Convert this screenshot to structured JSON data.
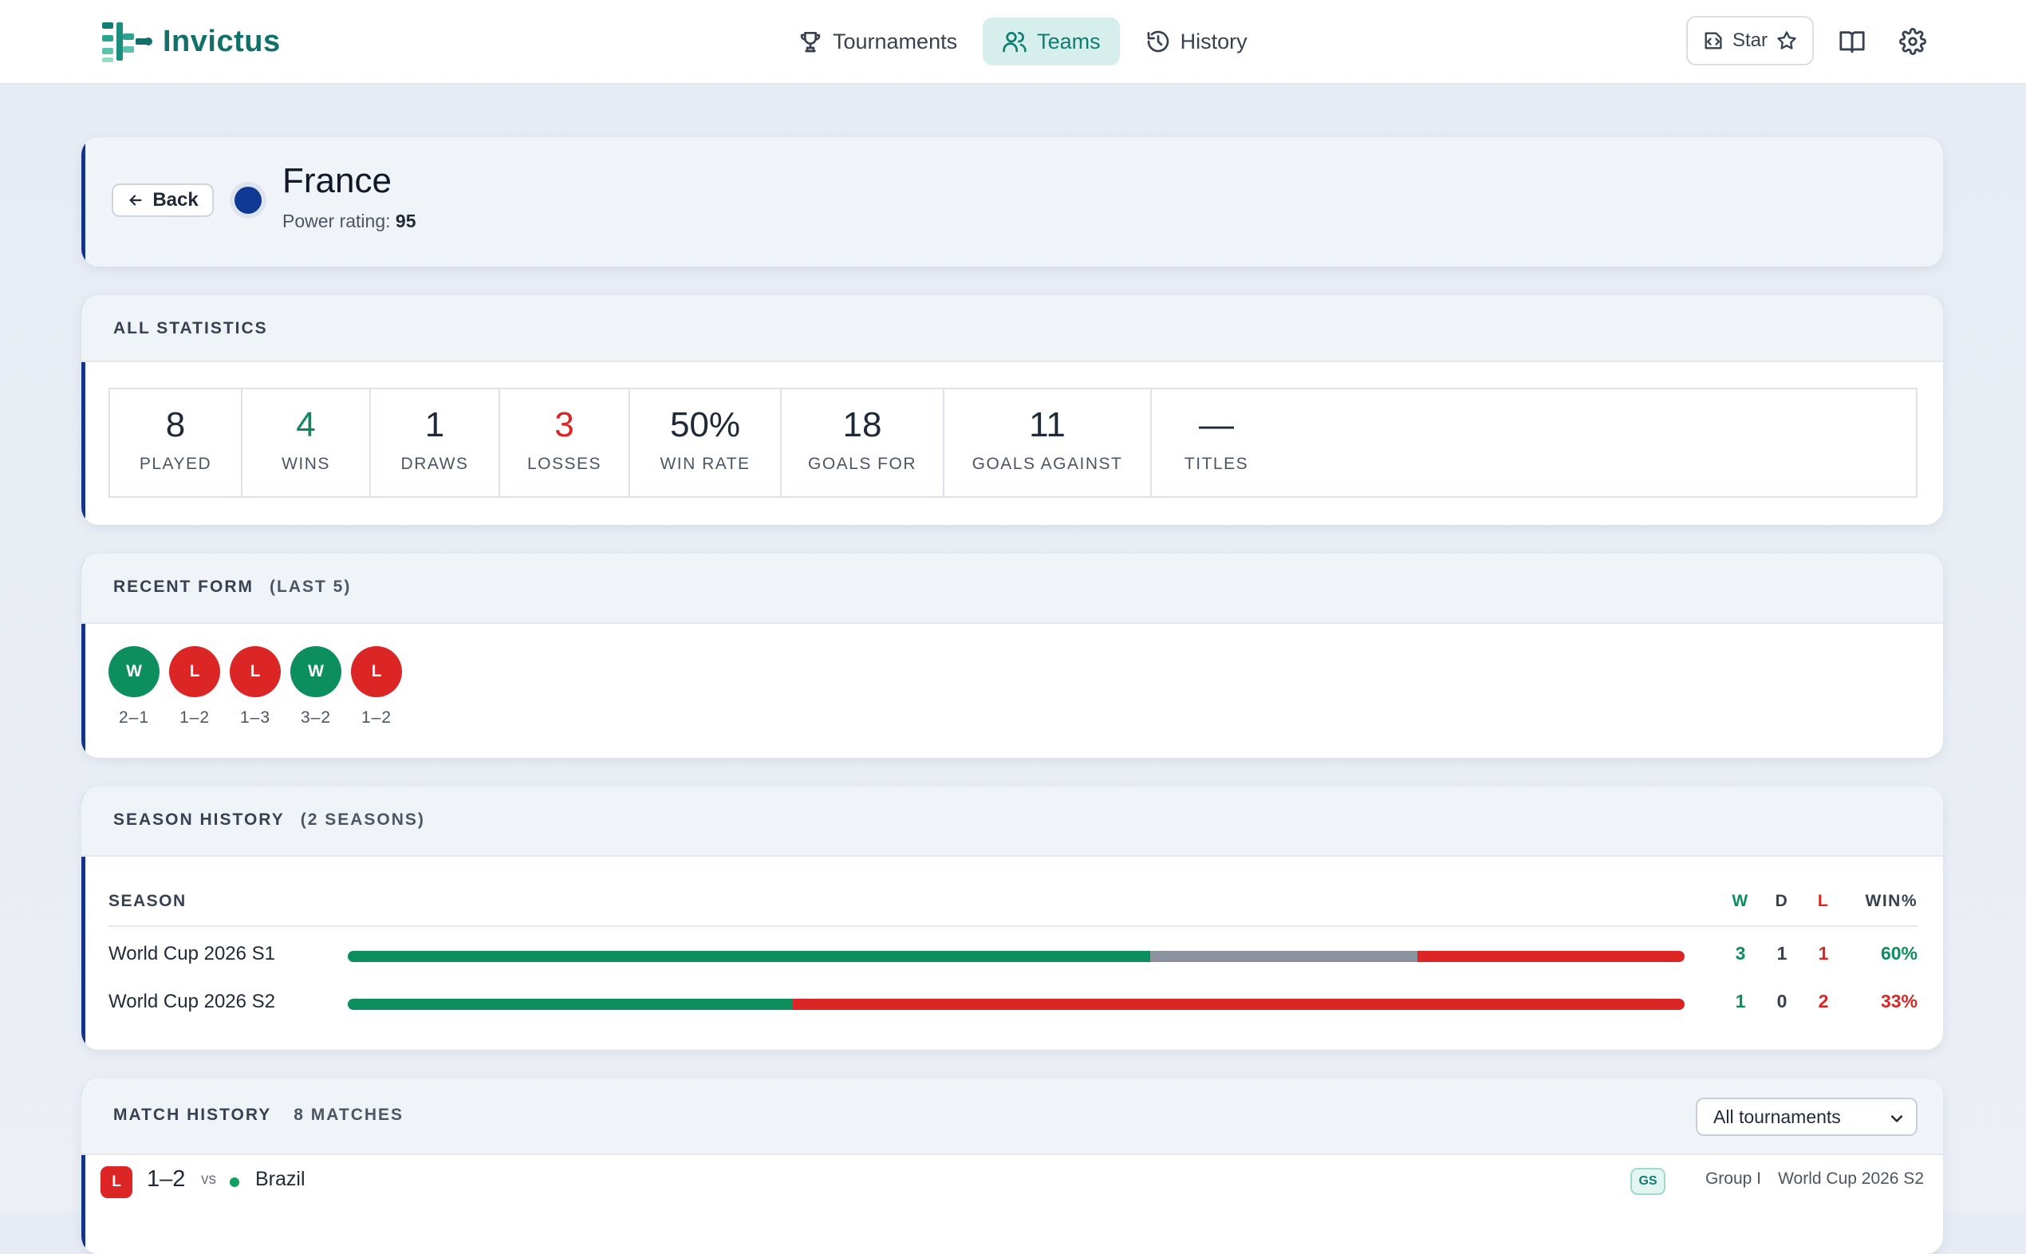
{
  "app": {
    "name": "Invictus"
  },
  "nav": [
    {
      "label": "Tournaments",
      "icon": "trophy-icon"
    },
    {
      "label": "Teams",
      "icon": "users-icon",
      "active": true
    },
    {
      "label": "History",
      "icon": "history-icon"
    }
  ],
  "toolbar": {
    "star_label": "Star"
  },
  "team": {
    "back_label": "Back",
    "name": "France",
    "power_label": "Power rating:",
    "power_value": "95",
    "color": "#0f3a94"
  },
  "stats": {
    "title": "ALL STATISTICS",
    "items": [
      {
        "value": "8",
        "label": "PLAYED"
      },
      {
        "value": "4",
        "label": "WINS"
      },
      {
        "value": "1",
        "label": "DRAWS"
      },
      {
        "value": "3",
        "label": "LOSSES"
      },
      {
        "value": "50%",
        "label": "WIN RATE"
      },
      {
        "value": "18",
        "label": "GOALS FOR"
      },
      {
        "value": "11",
        "label": "GOALS AGAINST"
      },
      {
        "value": "—",
        "label": "TITLES"
      }
    ]
  },
  "form": {
    "title": "RECENT FORM",
    "subtitle": "(LAST 5)",
    "items": [
      {
        "result": "W",
        "score": "2–1"
      },
      {
        "result": "L",
        "score": "1–2"
      },
      {
        "result": "L",
        "score": "1–3"
      },
      {
        "result": "W",
        "score": "3–2"
      },
      {
        "result": "L",
        "score": "1–2"
      }
    ]
  },
  "seasons": {
    "title": "SEASON HISTORY",
    "subtitle": "(2 SEASONS)",
    "headers": {
      "season": "SEASON",
      "w": "W",
      "d": "D",
      "l": "L",
      "pct": "WIN%"
    },
    "rows": [
      {
        "name": "World Cup 2026 S1",
        "w": "3",
        "d": "1",
        "l": "1",
        "pct": "60%",
        "bar": {
          "w": 0.6,
          "d": 0.2,
          "l": 0.2
        }
      },
      {
        "name": "World Cup 2026 S2",
        "w": "1",
        "d": "0",
        "l": "2",
        "pct": "33%",
        "bar": {
          "w": 0.333,
          "d": 0,
          "l": 0.667
        }
      }
    ],
    "colors": {
      "win": "#0c8e5f",
      "draw": "#8a929e",
      "loss": "#dc2626"
    }
  },
  "matches": {
    "title": "MATCH HISTORY",
    "count": "8 MATCHES",
    "filter_value": "All tournaments",
    "rows": [
      {
        "result": "L",
        "score": "1–2",
        "vs": "vs",
        "opponent": "Brazil",
        "stage": "GS",
        "group": "Group I",
        "tournament": "World Cup 2026 S2"
      }
    ]
  }
}
